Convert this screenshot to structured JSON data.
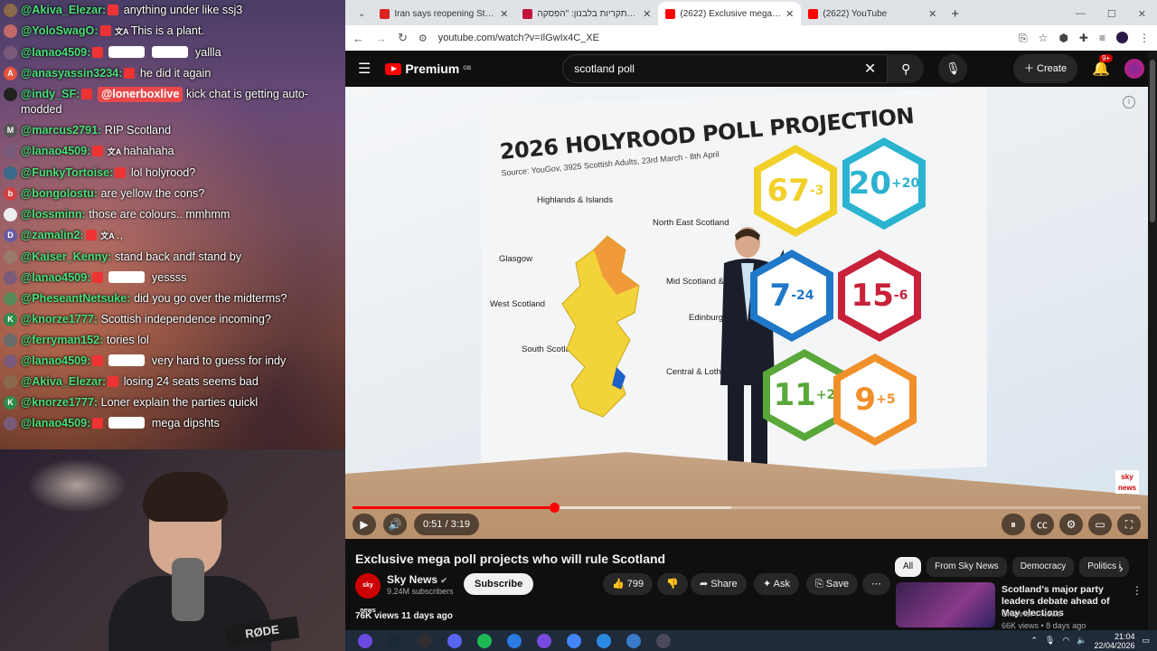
{
  "chat": {
    "messages": [
      {
        "user": "@Akiva_Elezar:",
        "text": "anything under like ssj3",
        "avatar_color": "#8a6a4a",
        "avatar_letter": "",
        "tags": [
          "emote"
        ]
      },
      {
        "user": "@YoloSwagO:",
        "text": "This is a plant.",
        "avatar_color": "#c26a6a",
        "avatar_letter": "",
        "tags": [
          "emote",
          "translate"
        ]
      },
      {
        "user": "@lanao4509:",
        "text": "yallla",
        "avatar_color": "#7a5a7a",
        "avatar_letter": "",
        "tags": [
          "emote",
          "badge",
          "badge"
        ]
      },
      {
        "user": "@anasyassin3234:",
        "text": "he did it again",
        "avatar_color": "#e5533e",
        "avatar_letter": "A",
        "tags": [
          "emote"
        ]
      },
      {
        "user": "@indy_SF:",
        "text": "kick chat is getting auto-modded",
        "mention": "@lonerboxlive",
        "avatar_color": "#222",
        "avatar_letter": "",
        "tags": [
          "emote"
        ]
      },
      {
        "user": "@marcus2791:",
        "text": "RIP Scotland",
        "avatar_color": "#555",
        "avatar_letter": "M",
        "tags": []
      },
      {
        "user": "@lanao4509:",
        "text": "hahahaha",
        "avatar_color": "#7a5a7a",
        "avatar_letter": "",
        "tags": [
          "emote",
          "translate"
        ]
      },
      {
        "user": "@FunkyTortoise:",
        "text": "lol holyrood?",
        "avatar_color": "#3a6a8a",
        "avatar_letter": "",
        "tags": [
          "emote"
        ]
      },
      {
        "user": "@bongolostu:",
        "text": "are yellow the cons?",
        "avatar_color": "#d04040",
        "avatar_letter": "b",
        "tags": []
      },
      {
        "user": "@lossminn:",
        "text": "those are colours.. mmhmm",
        "avatar_color": "#eee",
        "avatar_letter": "",
        "tags": []
      },
      {
        "user": "@zamalin2:",
        "text": ".,",
        "avatar_color": "#6a5aa0",
        "avatar_letter": "D",
        "tags": [
          "emote",
          "translate"
        ]
      },
      {
        "user": "@Kaiser_Kenny:",
        "text": "stand back andf stand by",
        "avatar_color": "#9a7a6a",
        "avatar_letter": "",
        "tags": []
      },
      {
        "user": "@lanao4509:",
        "text": "yessss",
        "avatar_color": "#7a5a7a",
        "avatar_letter": "",
        "tags": [
          "emote",
          "badge"
        ]
      },
      {
        "user": "@PheseantNetsuke:",
        "text": "did you go over the midterms?",
        "avatar_color": "#5a8a5a",
        "avatar_letter": "",
        "tags": []
      },
      {
        "user": "@knorze1777:",
        "text": "Scottish independence incoming?",
        "avatar_color": "#2f8a4a",
        "avatar_letter": "K",
        "tags": []
      },
      {
        "user": "@ferryman152:",
        "text": "tories lol",
        "avatar_color": "#6a6a6a",
        "avatar_letter": "",
        "tags": []
      },
      {
        "user": "@lanao4509:",
        "text": "very hard to guess for indy",
        "avatar_color": "#7a5a7a",
        "avatar_letter": "",
        "tags": [
          "emote",
          "badge"
        ]
      },
      {
        "user": "@Akiva_Elezar:",
        "text": "losing 24 seats seems bad",
        "avatar_color": "#8a6a4a",
        "avatar_letter": "",
        "tags": [
          "emote"
        ]
      },
      {
        "user": "@knorze1777:",
        "text": "Loner explain the parties quickl",
        "avatar_color": "#2f8a4a",
        "avatar_letter": "K",
        "tags": []
      },
      {
        "user": "@lanao4509:",
        "text": "mega dipshts",
        "avatar_color": "#7a5a7a",
        "avatar_letter": "",
        "tags": [
          "emote",
          "badge"
        ]
      }
    ]
  },
  "webcam": {
    "mic_brand": "RØDE"
  },
  "browser": {
    "tabs": [
      {
        "label": "Iran says reopening Strait of Ho",
        "fav_color": "#d22"
      },
      {
        "label": "רצף התקריות בלבנון: \"הפסקה",
        "fav_color": "#c1143c"
      },
      {
        "label": "(2622) Exclusive mega poll proj",
        "fav_color": "#f00",
        "active": true
      },
      {
        "label": "(2622) YouTube",
        "fav_color": "#f00"
      }
    ],
    "url": "youtube.com/watch?v=IlGwIx4C_XE"
  },
  "youtube": {
    "logo_text": "Premium",
    "logo_region": "GB",
    "search_value": "scotland poll",
    "create_label": "Create",
    "notif_count": "9+",
    "video": {
      "title_text": "2026 HOLYROOD POLL PROJECTION",
      "source_text": "Source: YouGov, 3925 Scottish Adults, 23rd March - 8th April",
      "regions": [
        "Highlands & Islands",
        "North East Scotland",
        "Glasgow",
        "Mid Scotland & Fife",
        "West Scotland",
        "Edinburgh & Lothians",
        "South Scotland",
        "Central & Lothians"
      ],
      "hexes": [
        {
          "text": "67",
          "sup": "-3",
          "color": "#f2d02a"
        },
        {
          "text": "20",
          "sup": "+20",
          "color": "#2bb3d0"
        },
        {
          "text": "7",
          "sup": "-24",
          "color": "#1f78c8"
        },
        {
          "text": "15",
          "sup": "-6",
          "color": "#c8213a"
        },
        {
          "text": "11",
          "sup": "+2",
          "color": "#5aa83a"
        },
        {
          "text": "9",
          "sup": "+5",
          "color": "#f0902a"
        }
      ],
      "corner_logo": "sky news",
      "time_current": "0:51",
      "time_total": "3:19",
      "time_display": "0:51 / 3:19",
      "progress_fraction": 0.256
    },
    "info": {
      "title": "Exclusive mega poll projects who will rule Scotland",
      "channel": "Sky News",
      "channel_avatar": "sky news",
      "subscribers": "9.24M subscribers",
      "subscribe_label": "Subscribe",
      "likes": "799",
      "share_label": "Share",
      "ask_label": "Ask",
      "save_label": "Save",
      "stats": "76K views  11 days ago"
    },
    "chips": [
      "All",
      "From Sky News",
      "Democracy",
      "Politics i"
    ],
    "recommendation": {
      "title": "Scotland's major party leaders debate ahead of May elections",
      "channel": "Channel 4 News",
      "stats": "66K views • 8 days ago"
    }
  },
  "taskbar": {
    "apps": [
      {
        "name": "proton-icon",
        "color": "#6a4ae0"
      },
      {
        "name": "steam-icon",
        "color": "#1b2838"
      },
      {
        "name": "obs-icon",
        "color": "#302e31"
      },
      {
        "name": "discord-icon",
        "color": "#5865f2"
      },
      {
        "name": "spotify-icon",
        "color": "#1db954"
      },
      {
        "name": "app-icon",
        "color": "#2a7ae0"
      },
      {
        "name": "proton-vpn-icon",
        "color": "#7a4ae0"
      },
      {
        "name": "chrome-icon",
        "color": "#4285f4"
      },
      {
        "name": "app2-icon",
        "color": "#2a8ae0"
      },
      {
        "name": "calculator-icon",
        "color": "#3a7ac8"
      },
      {
        "name": "app3-icon",
        "color": "#4a4a5a"
      }
    ],
    "time": "21:04",
    "date": "22/04/2026"
  }
}
